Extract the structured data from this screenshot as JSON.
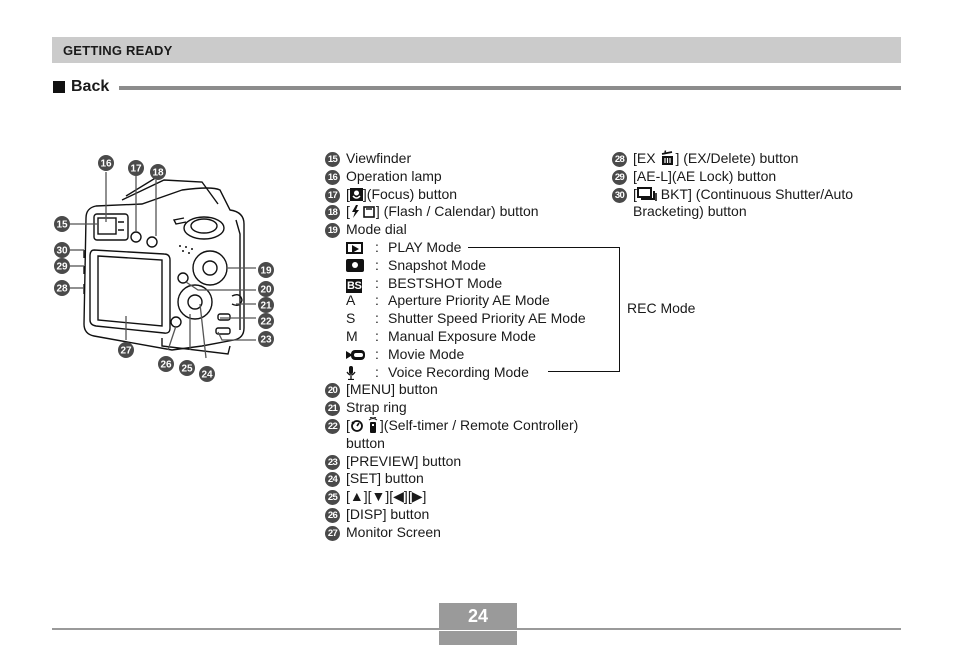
{
  "section": {
    "title": "GETTING READY"
  },
  "heading": {
    "title": "Back"
  },
  "figure": {
    "callouts": [
      "15",
      "16",
      "17",
      "18",
      "19",
      "20",
      "21",
      "22",
      "23",
      "24",
      "25",
      "26",
      "27",
      "28",
      "29",
      "30"
    ]
  },
  "parts_col1": [
    {
      "num": "15",
      "label": "Viewfinder"
    },
    {
      "num": "16",
      "label": "Operation lamp"
    },
    {
      "num": "17",
      "prefix": "[",
      "icon": "macro-flower-icon",
      "label": "](Focus) button"
    },
    {
      "num": "18",
      "prefix": "[",
      "icon": "flash-calendar-icon",
      "label": "] (Flash / Calendar) button"
    },
    {
      "num": "19",
      "label": "Mode dial"
    }
  ],
  "mode_dial": {
    "modes": [
      {
        "mark": "play-icon",
        "label": "PLAY Mode"
      },
      {
        "mark": "camera-icon",
        "label": "Snapshot Mode"
      },
      {
        "mark": "bestshot-icon",
        "mark_text": "BS",
        "label": "BESTSHOT Mode"
      },
      {
        "mark_text": "A",
        "label": "Aperture Priority AE Mode"
      },
      {
        "mark_text": "S",
        "label": "Shutter Speed Priority AE Mode"
      },
      {
        "mark_text": "M",
        "label": "Manual Exposure Mode"
      },
      {
        "mark": "movie-icon",
        "label": "Movie Mode"
      },
      {
        "mark": "microphone-icon",
        "label": "Voice Recording Mode"
      }
    ],
    "colon": ":",
    "group_label": "REC Mode"
  },
  "parts_col1_after": [
    {
      "num": "20",
      "label": "[MENU] button"
    },
    {
      "num": "21",
      "label": "Strap ring"
    },
    {
      "num": "22",
      "prefix": "[",
      "icon": "selftimer-remote-icon",
      "label": "](Self-timer / Remote Controller) button"
    },
    {
      "num": "23",
      "label": "[PREVIEW] button"
    },
    {
      "num": "24",
      "label": "[SET] button"
    },
    {
      "num": "25",
      "label": "[▲][▼][◀][▶]"
    },
    {
      "num": "26",
      "label": "[DISP] button"
    },
    {
      "num": "27",
      "label": "Monitor Screen"
    }
  ],
  "parts_col2": [
    {
      "num": "28",
      "prefix": "[EX ",
      "icon": "trash-icon",
      "label": "] (EX/Delete) button"
    },
    {
      "num": "29",
      "label": "[AE-L](AE Lock) button"
    },
    {
      "num": "30",
      "prefix": "[",
      "icon": "continuous-shutter-icon",
      "label": " BKT] (Continuous Shutter/Auto Bracketing) button"
    }
  ],
  "footer": {
    "page_number": "24"
  }
}
